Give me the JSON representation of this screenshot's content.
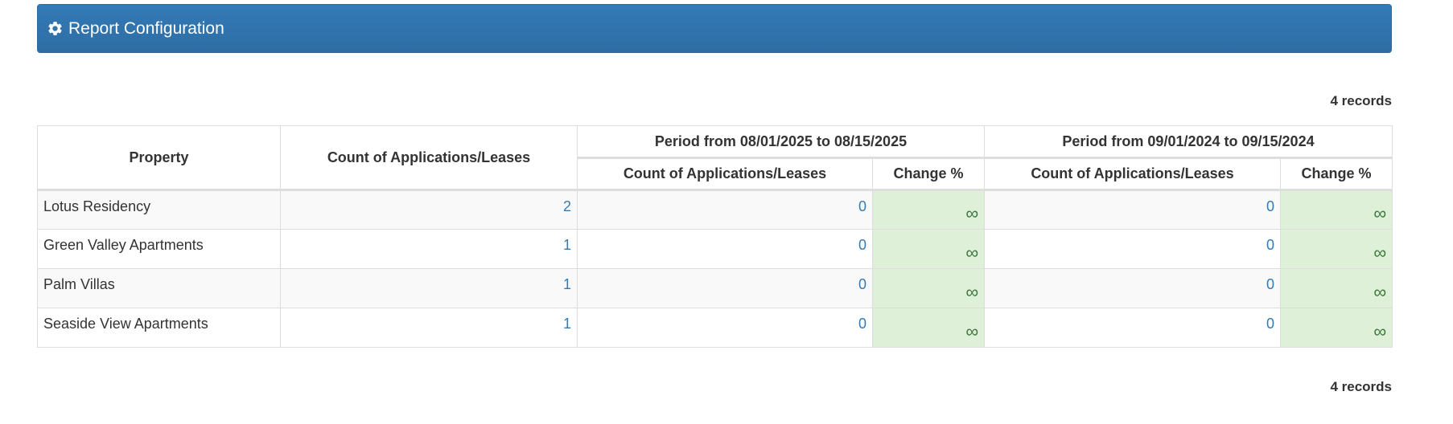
{
  "config_panel": {
    "title": "Report Configuration",
    "icon": "gear-icon"
  },
  "records_label_top": "4 records",
  "records_label_bottom": "4 records",
  "table": {
    "headers": {
      "property": "Property",
      "count": "Count of Applications/Leases",
      "period1": "Period from 08/01/2025 to 08/15/2025",
      "period2": "Period from 09/01/2024 to 09/15/2024",
      "period_count": "Count of Applications/Leases",
      "period_change": "Change %"
    },
    "rows": [
      {
        "property": "Lotus Residency",
        "count": "2",
        "p1_count": "0",
        "p1_change": "∞",
        "p2_count": "0",
        "p2_change": "∞"
      },
      {
        "property": "Green Valley Apartments",
        "count": "1",
        "p1_count": "0",
        "p1_change": "∞",
        "p2_count": "0",
        "p2_change": "∞"
      },
      {
        "property": "Palm Villas",
        "count": "1",
        "p1_count": "0",
        "p1_change": "∞",
        "p2_count": "0",
        "p2_change": "∞"
      },
      {
        "property": "Seaside View Apartments",
        "count": "1",
        "p1_count": "0",
        "p1_change": "∞",
        "p2_count": "0",
        "p2_change": "∞"
      }
    ]
  },
  "colors": {
    "panel": "#337ab7",
    "link": "#337ab7",
    "change_bg": "#dff0d8",
    "change_text": "#3c763d"
  }
}
